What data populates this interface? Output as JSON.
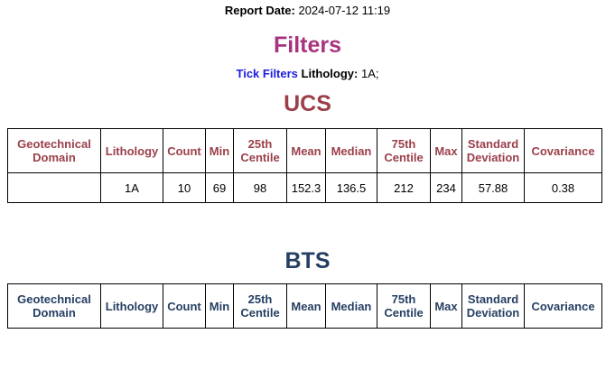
{
  "report_date": {
    "label": "Report Date:",
    "value": "2024-07-12 11:19"
  },
  "filters": {
    "title": "Filters",
    "tick_filters_label": "Tick Filters",
    "lithology_label": "Lithology:",
    "lithology_value": "1A;"
  },
  "columns": [
    "Geotechnical Domain",
    "Lithology",
    "Count",
    "Min",
    "25th Centile",
    "Mean",
    "Median",
    "75th Centile",
    "Max",
    "Standard Deviation",
    "Covariance"
  ],
  "ucs": {
    "title": "UCS",
    "rows": [
      [
        "",
        "1A",
        "10",
        "69",
        "98",
        "152.3",
        "136.5",
        "212",
        "234",
        "57.88",
        "0.38"
      ]
    ]
  },
  "bts": {
    "title": "BTS",
    "rows": []
  },
  "colors": {
    "filters_title": "#a8337f",
    "tick_filters": "#1c1ce0",
    "ucs_accent": "#9b3f4a",
    "bts_accent": "#263f63"
  }
}
